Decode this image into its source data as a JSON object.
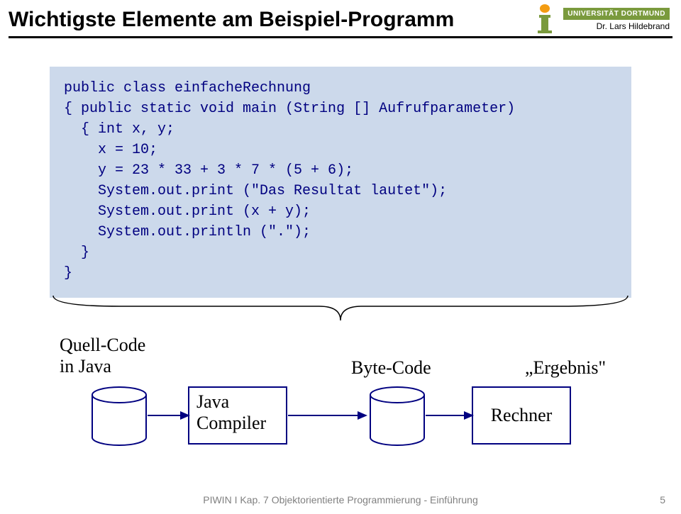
{
  "header": {
    "title": "Wichtigste Elemente am Beispiel-Programm",
    "university": "UNIVERSITÄT DORTMUND",
    "author": "Dr. Lars Hildebrand"
  },
  "code": {
    "line1": "public class einfacheRechnung",
    "line2": "{ public static void main (String [] Aufrufparameter)",
    "line3": "  { int x, y;",
    "line4": "    x = 10;",
    "line5": "    y = 23 * 33 + 3 * 7 * (5 + 6);",
    "line6": "    System.out.print (\"Das Resultat lautet\");",
    "line7": "    System.out.print (x + y);",
    "line8": "    System.out.println (\".\");",
    "line9": "  }",
    "line10": "}"
  },
  "diagram": {
    "quell_label_1": "Quell-Code",
    "quell_label_2": "in Java",
    "byte_label": "Byte-Code",
    "ergebnis_label": "„Ergebnis\"",
    "compiler_1": "Java",
    "compiler_2": "Compiler",
    "rechner": "Rechner"
  },
  "footer": {
    "text": "PIWIN I Kap. 7 Objektorientierte Programmierung - Einführung",
    "page": "5"
  }
}
